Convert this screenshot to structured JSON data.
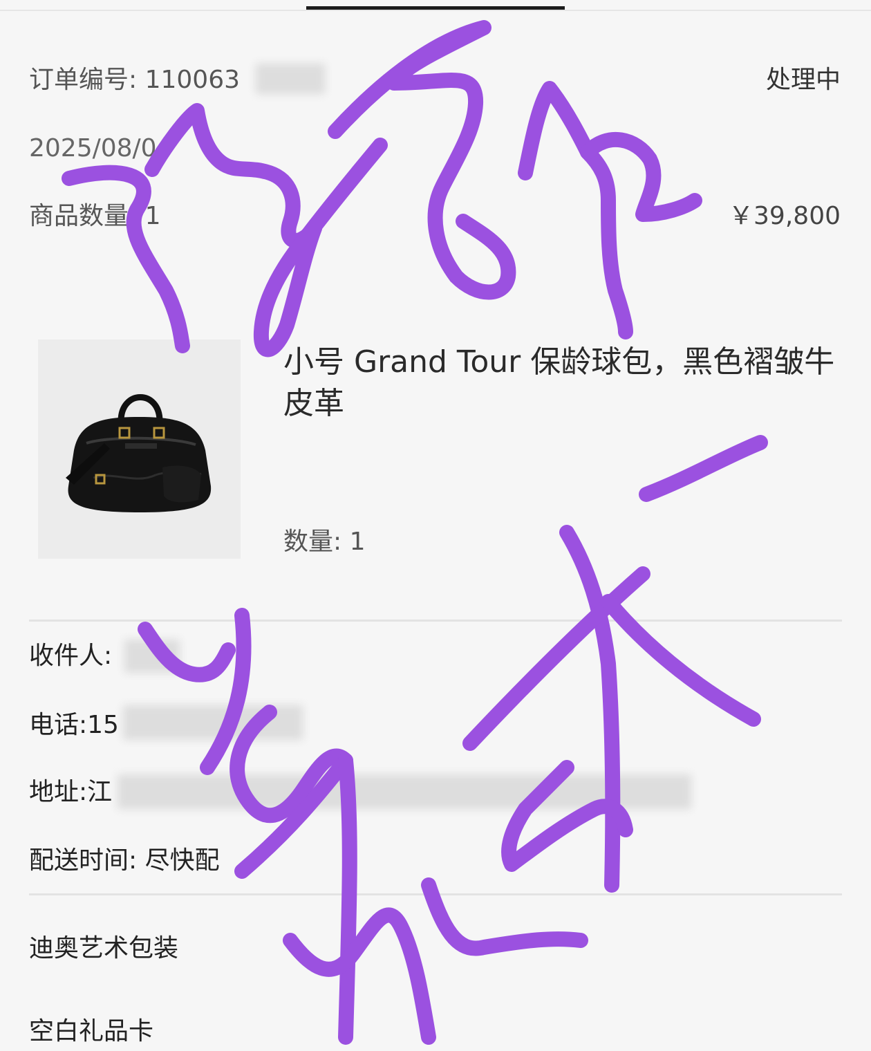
{
  "order": {
    "number_label": "订单编号: 110063",
    "status": "处理中",
    "date": "2025/08/0",
    "count_label": "商品数量: 1",
    "total_price": "￥39,800"
  },
  "product": {
    "name": "小号 Grand Tour 保龄球包，黑色褶皱牛皮革",
    "quantity_label": "数量: 1",
    "image_icon": "handbag-image"
  },
  "shipping": {
    "recipient_label": "收件人:",
    "phone_label": "电话:15",
    "address_label": "地址:江",
    "delivery_label": "配送时间: 尽快配"
  },
  "options": {
    "gift_wrap": "迪奥艺术包装",
    "gift_card": "空白礼品卡"
  },
  "colors": {
    "scribble": "#9b51e0",
    "background": "#f6f6f6"
  }
}
